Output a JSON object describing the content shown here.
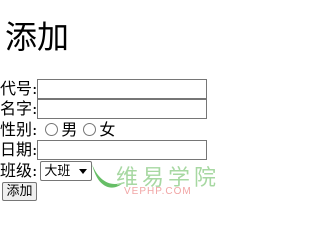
{
  "form": {
    "title": "添加",
    "fields": {
      "code": {
        "label": "代号:",
        "value": ""
      },
      "name": {
        "label": "名字:",
        "value": ""
      },
      "gender": {
        "label": "性别:",
        "options": [
          "男",
          "女"
        ]
      },
      "date": {
        "label": "日期:",
        "value": ""
      },
      "class": {
        "label": "班级:",
        "selected": "大班"
      }
    },
    "submit_label": "添加"
  },
  "watermark": {
    "text_cn": "维易学院",
    "text_en": "VEPHP.COM",
    "colors": {
      "cn_text": "#a7d8a2",
      "en_text": "#f1a5a5",
      "swoosh": "#4bb34b"
    }
  }
}
